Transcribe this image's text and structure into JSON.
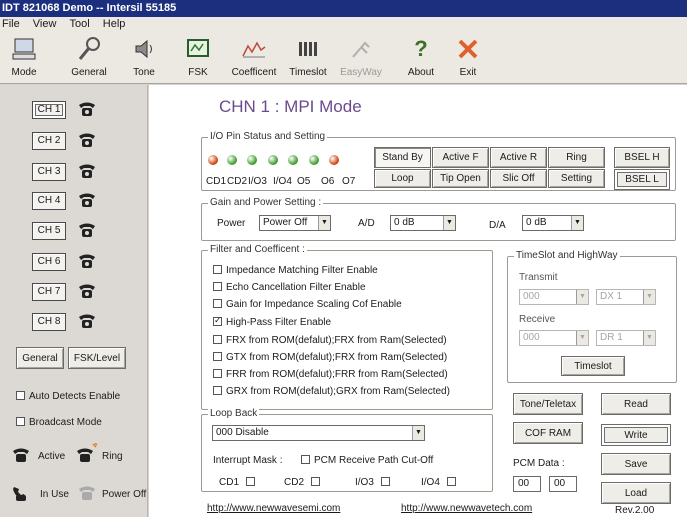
{
  "window": {
    "title": "IDT 821068 Demo -- Intersil 55185"
  },
  "menu": [
    "File",
    "View",
    "Tool",
    "Help"
  ],
  "toolbar": [
    {
      "label": "Mode",
      "icon": "computer-icon"
    },
    {
      "label": "General",
      "icon": "wrench-icon"
    },
    {
      "label": "Tone",
      "icon": "speaker-icon"
    },
    {
      "label": "FSK",
      "icon": "fsk-icon"
    },
    {
      "label": "Coefficent",
      "icon": "waveform-icon"
    },
    {
      "label": "Timeslot",
      "icon": "timeslot-icon"
    },
    {
      "label": "EasyWay",
      "icon": "easyway-icon",
      "disabled": true
    },
    {
      "label": "About",
      "icon": "question-icon"
    },
    {
      "label": "Exit",
      "icon": "exit-icon"
    }
  ],
  "channels": [
    "CH 1",
    "CH 2",
    "CH 3",
    "CH 4",
    "CH 5",
    "CH 6",
    "CH 7",
    "CH 8"
  ],
  "left": {
    "general_btn": "General",
    "fsk_btn": "FSK/Level",
    "auto_detect": "Auto Detects Enable",
    "broadcast": "Broadcast Mode",
    "legend": {
      "active": "Active",
      "ring": "Ring",
      "in_use": "In Use",
      "power_off": "Power Off"
    }
  },
  "page_title": "CHN 1 : MPI Mode",
  "io": {
    "label": "I/O Pin Status and Setting",
    "pins": [
      "CD1",
      "CD2",
      "I/O3",
      "I/O4",
      "O5",
      "O6",
      "O7"
    ],
    "led_colors": [
      "#d04610",
      "#3e9e2d",
      "#3e9e2d",
      "#3e9e2d",
      "#3e9e2d",
      "#3e9e2d",
      "#d04610"
    ],
    "row1": [
      "Stand By",
      "Active F",
      "Active R",
      "Ring"
    ],
    "row2": [
      "Loop",
      "Tip Open",
      "Slic Off",
      "Setting"
    ],
    "bsel_h": "BSEL H",
    "bsel_l": "BSEL L"
  },
  "gain": {
    "label": "Gain and Power Setting :",
    "power_label": "Power",
    "power_value": "Power Off",
    "ad_label": "A/D",
    "ad_value": "0 dB",
    "da_label": "D/A",
    "da_value": "0 dB"
  },
  "filter": {
    "label": "Filter and Coefficent :",
    "items": [
      {
        "text": "Impedance Matching Filter Enable",
        "checked": false
      },
      {
        "text": "Echo Cancellation Filter Enable",
        "checked": false
      },
      {
        "text": "Gain for Impedance Scaling Cof Enable",
        "checked": false
      },
      {
        "text": "High-Pass Filter Enable",
        "checked": true
      },
      {
        "text": "FRX from ROM(defalut);FRX from Ram(Selected)",
        "checked": false
      },
      {
        "text": "GTX from ROM(defalut);FRX from Ram(Selected)",
        "checked": false
      },
      {
        "text": "FRR from ROM(defalut);FRR from Ram(Selected)",
        "checked": false
      },
      {
        "text": "GRX from ROM(defalut);GRX from Ram(Selected)",
        "checked": false
      }
    ]
  },
  "timeslot": {
    "label": "TimeSlot and HighWay",
    "transmit_label": "Transmit",
    "transmit_slot": "000",
    "transmit_dx": "DX 1",
    "receive_label": "Receive",
    "receive_slot": "000",
    "receive_dr": "DR 1",
    "button": "Timeslot"
  },
  "loopback": {
    "label": "Loop Back",
    "value": "000 Disable",
    "interrupt_label": "Interrupt Mask :",
    "pcm_path": "PCM Receive Path Cut-Off",
    "masks": [
      "CD1",
      "CD2",
      "I/O3",
      "I/O4"
    ]
  },
  "right_buttons": {
    "tone_teletax": "Tone/Teletax",
    "read": "Read",
    "cof_ram": "COF RAM",
    "write": "Write",
    "save": "Save",
    "load": "Load",
    "pcm_label": "PCM Data :",
    "pcm1": "00",
    "pcm2": "00"
  },
  "footer": {
    "link1": "http://www.newwavesemi.com",
    "link2": "http://www.newwavetech.com",
    "version": "Rev.2.00"
  }
}
